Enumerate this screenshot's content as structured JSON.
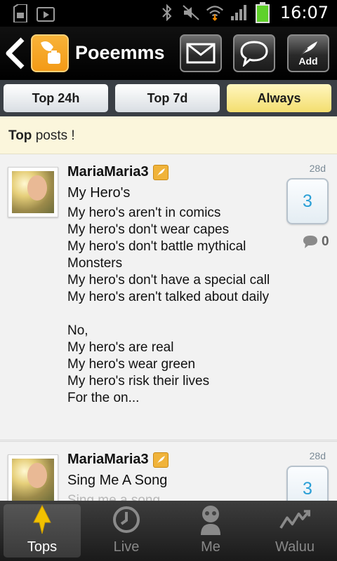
{
  "status_bar": {
    "time": "16:07",
    "icons": [
      "sd-card-icon",
      "play-store-icon",
      "bluetooth-icon",
      "mute-icon",
      "wifi-icon",
      "signal-icon",
      "battery-icon"
    ]
  },
  "app": {
    "title": "Poeemms",
    "add_label": "Add"
  },
  "tabs": [
    {
      "label": "Top 24h",
      "active": false
    },
    {
      "label": "Top 7d",
      "active": false
    },
    {
      "label": "Always",
      "active": true
    }
  ],
  "banner": {
    "bold": "Top",
    "rest": " posts !"
  },
  "posts": [
    {
      "author": "MariaMaria3",
      "title": "My Hero's",
      "body": "My hero's aren't in comics\nMy hero's don't wear capes\nMy hero's don't battle mythical Monsters\nMy hero's don't have a special call\nMy hero's aren't talked about daily\n\nNo,\nMy hero's are real\nMy hero's wear green\nMy hero's risk their lives\nFor the on...",
      "age": "28d",
      "votes": "3",
      "comments": "0"
    },
    {
      "author": "MariaMaria3",
      "title": "Sing Me A Song",
      "body": "Sing me a song",
      "age": "28d",
      "votes": "3"
    }
  ],
  "nav": [
    {
      "label": "Tops",
      "icon": "tops-arrow-icon",
      "active": true
    },
    {
      "label": "Live",
      "icon": "clock-icon",
      "active": false
    },
    {
      "label": "Me",
      "icon": "profile-icon",
      "active": false
    },
    {
      "label": "Waluu",
      "icon": "waluu-icon",
      "active": false
    }
  ],
  "colors": {
    "accent_orange": "#f39a16",
    "vote_blue": "#2a9fd6",
    "active_tab": "#f3de6f",
    "banner_bg": "#fbf6dc",
    "tops_icon_yellow": "#f2c100"
  }
}
